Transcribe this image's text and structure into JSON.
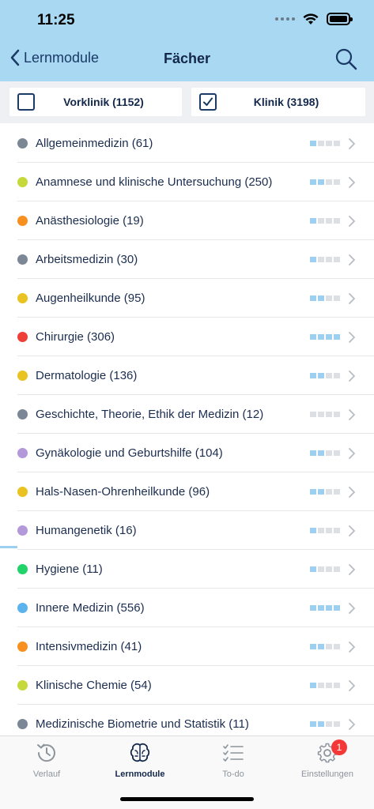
{
  "status": {
    "time": "11:25"
  },
  "nav": {
    "back_label": "Lernmodule",
    "title": "Fächer"
  },
  "filters": [
    {
      "label": "Vorklinik (1152)",
      "checked": false
    },
    {
      "label": "Klinik (3198)",
      "checked": true
    }
  ],
  "subjects": [
    {
      "label": "Allgemeinmedizin (61)",
      "color": "#7b8794",
      "progress": 1
    },
    {
      "label": "Anamnese und klinische Untersuchung (250)",
      "color": "#c5d93a",
      "progress": 2
    },
    {
      "label": "Anästhesiologie (19)",
      "color": "#f7901e",
      "progress": 1
    },
    {
      "label": "Arbeitsmedizin (30)",
      "color": "#7b8794",
      "progress": 1
    },
    {
      "label": "Augenheilkunde (95)",
      "color": "#e8c322",
      "progress": 2
    },
    {
      "label": "Chirurgie (306)",
      "color": "#ee4038",
      "progress": 4
    },
    {
      "label": "Dermatologie (136)",
      "color": "#e8c322",
      "progress": 2
    },
    {
      "label": "Geschichte, Theorie, Ethik der Medizin (12)",
      "color": "#7b8794",
      "progress": 0
    },
    {
      "label": "Gynäkologie und Geburtshilfe (104)",
      "color": "#b399d9",
      "progress": 2
    },
    {
      "label": "Hals-Nasen-Ohrenheilkunde (96)",
      "color": "#e8c322",
      "progress": 2
    },
    {
      "label": "Humangenetik (16)",
      "color": "#b399d9",
      "progress": 1
    },
    {
      "label": "Hygiene (11)",
      "color": "#22d36a",
      "progress": 1
    },
    {
      "label": "Innere Medizin (556)",
      "color": "#5bb3ee",
      "progress": 4
    },
    {
      "label": "Intensivmedizin (41)",
      "color": "#f7901e",
      "progress": 2
    },
    {
      "label": "Klinische Chemie (54)",
      "color": "#c5d93a",
      "progress": 1
    },
    {
      "label": "Medizinische Biometrie und Statistik (11)",
      "color": "#7b8794",
      "progress": 2
    }
  ],
  "tabs": [
    {
      "label": "Verlauf",
      "icon": "history-icon",
      "active": false
    },
    {
      "label": "Lernmodule",
      "icon": "brain-icon",
      "active": true
    },
    {
      "label": "To-do",
      "icon": "checklist-icon",
      "active": false
    },
    {
      "label": "Einstellungen",
      "icon": "gear-icon",
      "active": false,
      "badge": "1"
    }
  ]
}
